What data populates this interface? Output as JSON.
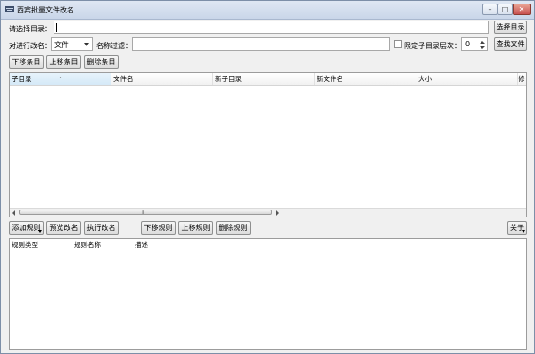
{
  "window": {
    "title": "西宾批量文件改名",
    "minimize": "–",
    "maximize": "□",
    "close": "✕"
  },
  "top": {
    "dir_label": "请选择目录：",
    "dir_value": "",
    "choose_dir": "选择目录",
    "rename_target_label": "对进行改名：",
    "rename_target_value": "文件",
    "name_filter_label": "名称过滤：",
    "name_filter_value": "",
    "limit_depth_label": "限定子目录层次：",
    "depth_value": "0",
    "find_files": "查找文件"
  },
  "item_buttons": {
    "down": "下移条目",
    "up": "上移条目",
    "delete": "删除条目"
  },
  "file_table": {
    "columns": [
      "子目录",
      "文件名",
      "新子目录",
      "新文件名",
      "大小",
      "修"
    ],
    "sort_glyph": "˄",
    "scroll_grip": "⦀"
  },
  "rule_buttons": {
    "add": "添加规则",
    "preview": "预览改名",
    "execute": "执行改名",
    "down": "下移规则",
    "up": "上移规则",
    "delete": "删除规则",
    "about": "关于"
  },
  "rule_table": {
    "columns": [
      "规则类型",
      "规则名称",
      "描述"
    ]
  }
}
